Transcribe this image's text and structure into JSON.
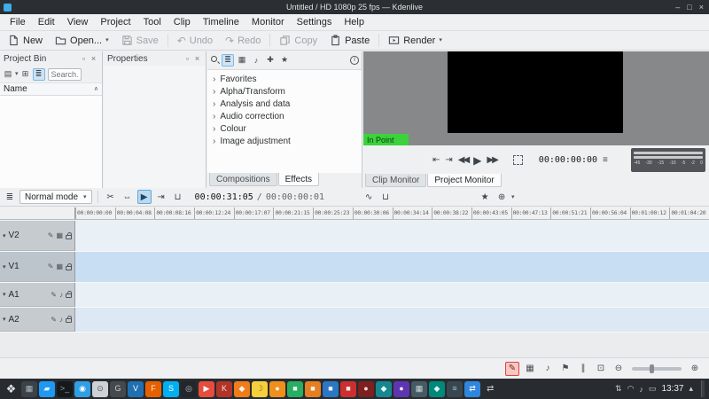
{
  "window": {
    "title": "Untitled / HD 1080p 25 fps — Kdenlive"
  },
  "menubar": {
    "items": [
      "File",
      "Edit",
      "View",
      "Project",
      "Tool",
      "Clip",
      "Timeline",
      "Monitor",
      "Settings",
      "Help"
    ]
  },
  "toolbar": {
    "new_label": "New",
    "open_label": "Open...",
    "save_label": "Save",
    "undo_label": "Undo",
    "redo_label": "Redo",
    "copy_label": "Copy",
    "paste_label": "Paste",
    "render_label": "Render"
  },
  "project_bin": {
    "title": "Project Bin",
    "search_placeholder": "Search...",
    "name_header": "Name"
  },
  "properties_panel": {
    "title": "Properties"
  },
  "effects_panel": {
    "tabs": [
      {
        "label": "Compositions",
        "active": false
      },
      {
        "label": "Effects",
        "active": true
      }
    ],
    "categories": [
      "Favorites",
      "Alpha/Transform",
      "Analysis and data",
      "Audio correction",
      "Colour",
      "Image adjustment"
    ]
  },
  "monitor": {
    "overlay_label": "In Point",
    "timecode": "00:00:00:00",
    "tabs": [
      {
        "label": "Clip Monitor",
        "active": false
      },
      {
        "label": "Project Monitor",
        "active": true
      }
    ],
    "audio_meter_scale": [
      "-45",
      "-30",
      "-15",
      "-10",
      "-5",
      "-2",
      "0"
    ]
  },
  "timeline_toolbar": {
    "mode_label": "Normal mode",
    "position_timecode": "00:00:31:05",
    "separator": "/",
    "duration_timecode": "00:00:00:01"
  },
  "timeline": {
    "ruler_marks": [
      "00:00:00:00",
      "00:00:04:08",
      "00:00:08:16",
      "00:00:12:24",
      "00:00:17:07",
      "00:00:21:15",
      "00:00:25:23",
      "00:00:30:06",
      "00:00:34:14",
      "00:00:38:22",
      "00:00:43:05",
      "00:00:47:13",
      "00:00:51:21",
      "00:00:56:04",
      "00:01:00:12",
      "00:01:04:20"
    ],
    "tracks": [
      {
        "name": "V2",
        "kind": "video",
        "active": false
      },
      {
        "name": "V1",
        "kind": "video",
        "active": true
      },
      {
        "name": "A1",
        "kind": "audio",
        "active": false
      },
      {
        "name": "A2",
        "kind": "audio",
        "active": false
      }
    ]
  },
  "taskbar": {
    "clock": "13:37",
    "apps": [
      {
        "bg": "#3b4248",
        "fg": "#aeb9c1",
        "glyph": "▦"
      },
      {
        "bg": "#1d99f3",
        "fg": "#eaf5fd",
        "glyph": "▰"
      },
      {
        "bg": "#16191c",
        "fg": "#9aa7ae",
        "glyph": ">_"
      },
      {
        "bg": "#2f9fe5",
        "fg": "#ffffff",
        "glyph": "◉"
      },
      {
        "bg": "#ccd2d6",
        "fg": "#50565b",
        "glyph": "⊙"
      },
      {
        "bg": "#45494e",
        "fg": "#c9ced2",
        "glyph": "G"
      },
      {
        "bg": "#1f6fb2",
        "fg": "#ffffff",
        "glyph": "V"
      },
      {
        "bg": "#e66000",
        "fg": "#ffe9d2",
        "glyph": "F"
      },
      {
        "bg": "#00aff0",
        "fg": "#ffffff",
        "glyph": "S"
      },
      {
        "bg": "#23272b",
        "fg": "#b9c2c8",
        "glyph": "◎"
      },
      {
        "bg": "#e74c3c",
        "fg": "#ffffff",
        "glyph": "▶"
      },
      {
        "bg": "#b03428",
        "fg": "#ffd9d4",
        "glyph": "K"
      },
      {
        "bg": "#ef7d1a",
        "fg": "#fff3e6",
        "glyph": "◆"
      },
      {
        "bg": "#f6cf3e",
        "fg": "#8a6d00",
        "glyph": "☽"
      },
      {
        "bg": "#ef8f1c",
        "fg": "#fff7ec",
        "glyph": "●"
      },
      {
        "bg": "#27ae60",
        "fg": "#e9fbf1",
        "glyph": "■"
      },
      {
        "bg": "#e67e22",
        "fg": "#fff5ea",
        "glyph": "■"
      },
      {
        "bg": "#2d76c4",
        "fg": "#eaf3fc",
        "glyph": "■"
      },
      {
        "bg": "#cc2f2f",
        "fg": "#ffecec",
        "glyph": "■"
      },
      {
        "bg": "#7e2020",
        "fg": "#ffd9d9",
        "glyph": "●"
      },
      {
        "bg": "#18868f",
        "fg": "#e2fbff",
        "glyph": "◆"
      },
      {
        "bg": "#5e35b1",
        "fg": "#ece4f7",
        "glyph": "●"
      },
      {
        "bg": "#455a64",
        "fg": "#cfd8dc",
        "glyph": "▦"
      },
      {
        "bg": "#00897b",
        "fg": "#d9f5f2",
        "glyph": "◆"
      },
      {
        "bg": "#37474f",
        "fg": "#b0bec5",
        "glyph": "≡"
      },
      {
        "bg": "#2e86de",
        "fg": "#ffffff",
        "glyph": "⇄"
      }
    ]
  },
  "icons": {
    "caret_down": "▾",
    "to_in": "⇤",
    "to_out": "⇥",
    "rewind": "◀◀",
    "play": "▶",
    "forward": "▶▶",
    "menu": "≡",
    "undo": "↶",
    "redo": "↷",
    "track_config": "≣",
    "razor": "✂",
    "spacer": "⇔",
    "active_tool": "▶",
    "overwrite": "⊔",
    "mix": "∿",
    "insert": "⇥",
    "favorites_star": "★",
    "target": "⊕",
    "grid": "▦",
    "audio_note": "♪",
    "plus": "✚",
    "wand": "✎",
    "list": "≣",
    "sort_asc": "∧",
    "detach": "▫",
    "close": "×",
    "minimize": "–",
    "maximize": "□",
    "info": "i",
    "launcher": "❖",
    "net_arrows": "⇄",
    "tray_updown": "⇅",
    "wifi": "◠",
    "volume": "♪",
    "battery": "▭",
    "tray_caret": "▴",
    "zoom_in": "⊕",
    "zoom_out": "⊖",
    "zoom_fit": "⊡",
    "marker_flag": "⚑",
    "snap": "∥",
    "red_tool": "✎",
    "add_clip": "▤",
    "folder": "⊞"
  },
  "colors": {
    "accent": "#3daee9",
    "in_point_green": "#3bd23b",
    "active_track_blue": "#c8def2",
    "titlebar_bg": "#2b2f33",
    "taskbar_bg": "#282c30",
    "monitor_gray": "#868889"
  }
}
